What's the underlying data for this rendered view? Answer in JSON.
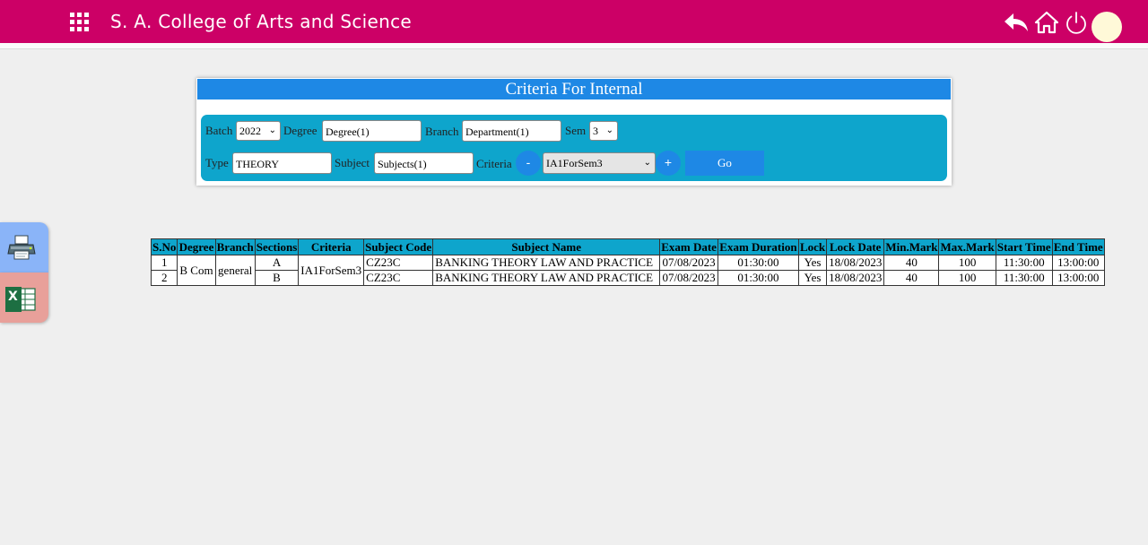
{
  "header": {
    "title": "S. A. College of Arts and Science"
  },
  "icons": {
    "menu": "apps-grid-icon",
    "back": "reply-arrow-icon",
    "home": "home-icon",
    "power": "power-icon",
    "print": "printer-icon",
    "excel": "excel-icon"
  },
  "colors": {
    "topbar": "#cc0066",
    "panel_header": "#1e88e5",
    "panel_body": "#0ea5cc",
    "button": "#1e88e5"
  },
  "panel": {
    "title": "Criteria For Internal",
    "batch_label": "Batch",
    "batch_value": "2022",
    "degree_label": "Degree",
    "degree_value": "Degree(1)",
    "branch_label": "Branch",
    "branch_value": "Department(1)",
    "sem_label": "Sem",
    "sem_value": "3",
    "type_label": "Type",
    "type_value": "THEORY",
    "subject_label": "Subject",
    "subject_value": "Subjects(1)",
    "criteria_label": "Criteria",
    "criteria_value": "IA1ForSem3",
    "minus_label": "-",
    "plus_label": "+",
    "go_label": "Go"
  },
  "side": {
    "excel_letter": "X"
  },
  "table": {
    "headers": [
      "S.No",
      "Degree",
      "Branch",
      "Sections",
      "Criteria",
      "Subject Code",
      "Subject Name",
      "Exam Date",
      "Exam Duration",
      "Lock",
      "Lock Date",
      "Min.Mark",
      "Max.Mark",
      "Start Time",
      "End Time"
    ],
    "degree": "B Com",
    "branch": "general",
    "criteria": "IA1ForSem3",
    "rows": [
      {
        "sno": "1",
        "section": "A",
        "subject_code": "CZ23C",
        "subject_name": "BANKING THEORY LAW AND PRACTICE",
        "exam_date": "07/08/2023",
        "duration": "01:30:00",
        "lock": "Yes",
        "lock_date": "18/08/2023",
        "min": "40",
        "max": "100",
        "start": "11:30:00",
        "end": "13:00:00"
      },
      {
        "sno": "2",
        "section": "B",
        "subject_code": "CZ23C",
        "subject_name": "BANKING THEORY LAW AND PRACTICE",
        "exam_date": "07/08/2023",
        "duration": "01:30:00",
        "lock": "Yes",
        "lock_date": "18/08/2023",
        "min": "40",
        "max": "100",
        "start": "11:30:00",
        "end": "13:00:00"
      }
    ]
  }
}
